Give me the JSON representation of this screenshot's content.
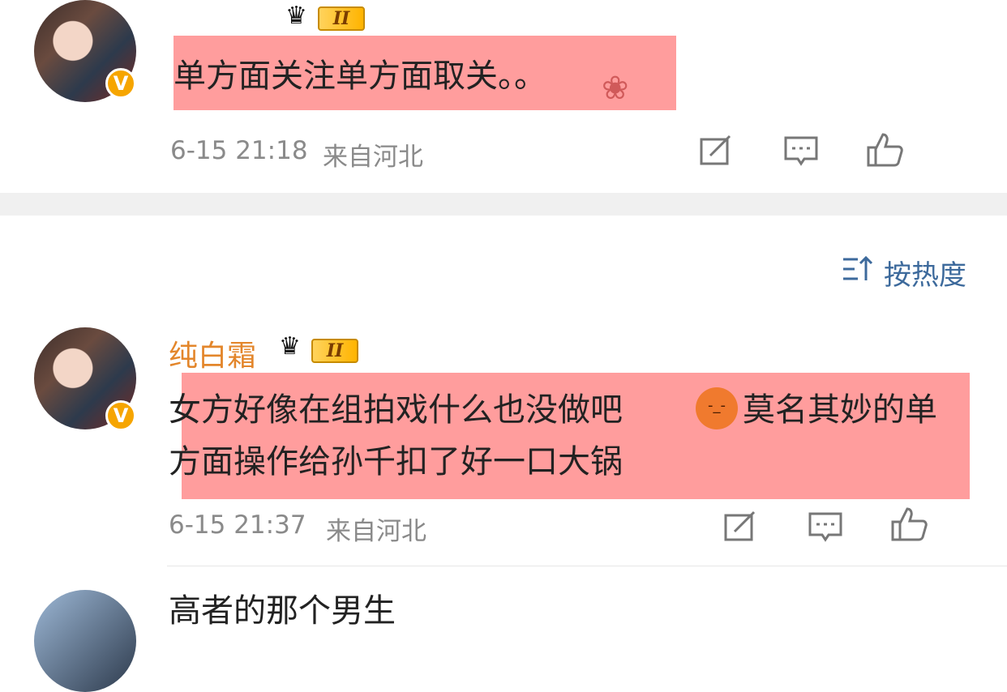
{
  "comments": [
    {
      "username": "",
      "level": "II",
      "text": "单方面关注单方面取关。。",
      "timestamp": "6-15 21:18",
      "location": "来自河北"
    },
    {
      "username": "纯白霜",
      "level": "II",
      "text_line1": "女方好像在组拍戏什么也没做吧",
      "emoji": "-_-",
      "text_line1_cont": "莫名其妙的单",
      "text_line2": "方面操作给孙千扣了好一口大锅",
      "timestamp": "6-15 21:37",
      "location": "来自河北"
    },
    {
      "text_partial": "高者的那个男生"
    }
  ],
  "sort": {
    "label": "按热度",
    "icon": "sort-icon"
  },
  "icons": {
    "share": "share-icon",
    "comment": "comment-icon",
    "like": "thumbs-up-icon",
    "crown": "crown-icon",
    "verified": "verified-badge-icon"
  },
  "colors": {
    "username": "#e3862b",
    "highlight": "#ff9d9d",
    "meta": "#8a8a8a",
    "sort": "#3d6a9c",
    "verified": "#f6a500"
  }
}
